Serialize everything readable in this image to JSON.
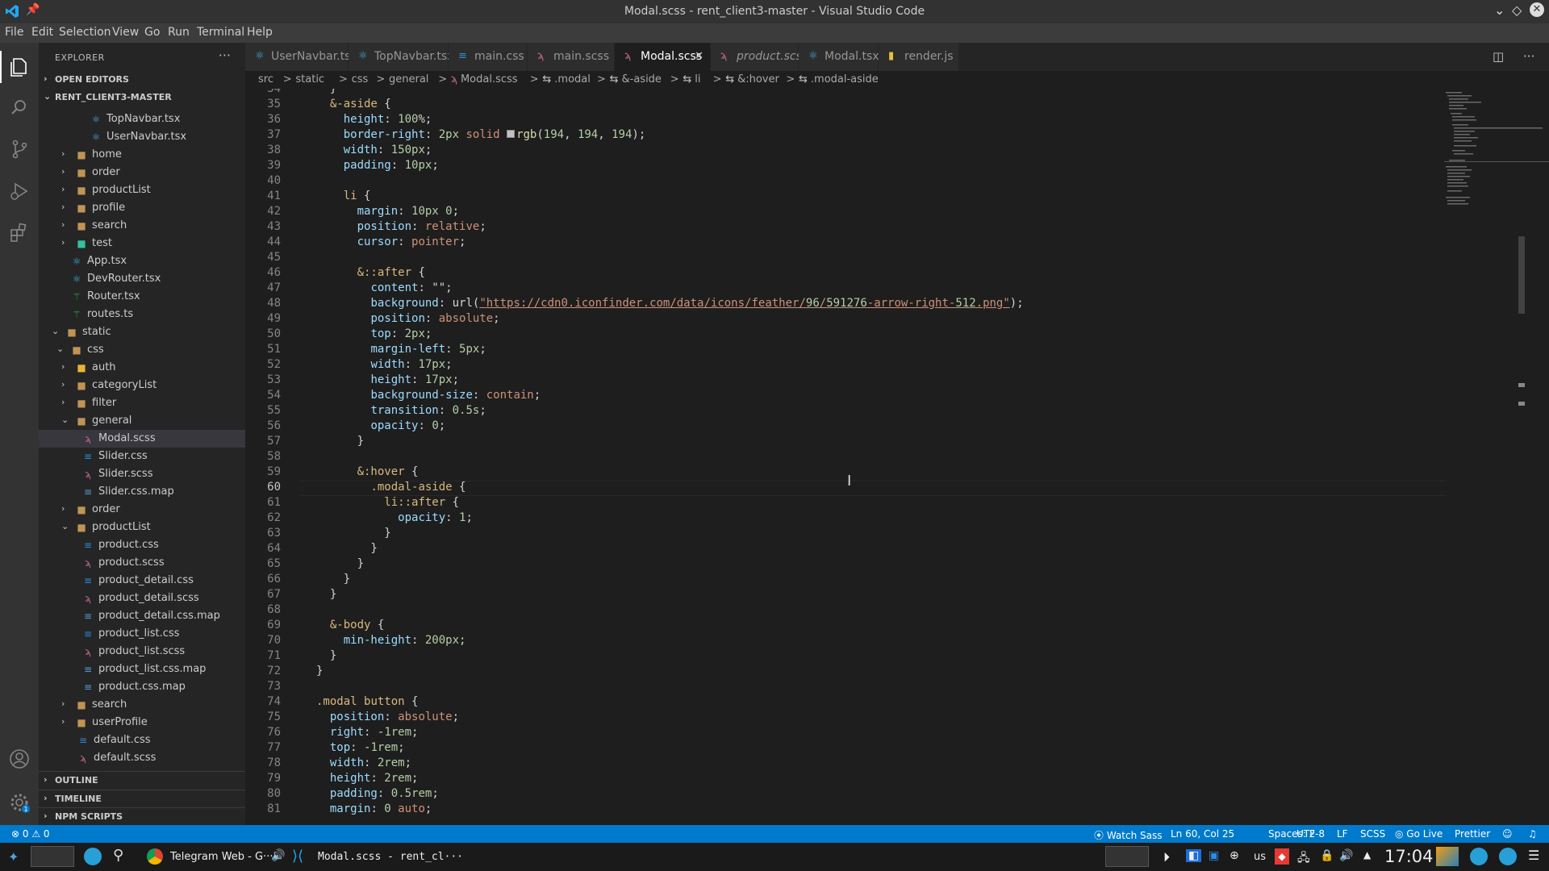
{
  "window": {
    "title": "Modal.scss - rent_client3-master - Visual Studio Code"
  },
  "menu": [
    "File",
    "Edit",
    "Selection",
    "View",
    "Go",
    "Run",
    "Terminal",
    "Help"
  ],
  "explorer": {
    "header": "EXPLORER",
    "more": "···",
    "open_editors": "OPEN EDITORS",
    "project": "RENT_CLIENT3-MASTER",
    "tree": [
      {
        "name": "TopNavbar.tsx",
        "type": "tsx"
      },
      {
        "name": "UserNavbar.tsx",
        "type": "tsx"
      },
      {
        "name": "home",
        "type": "folder"
      },
      {
        "name": "order",
        "type": "folder"
      },
      {
        "name": "productList",
        "type": "folder"
      },
      {
        "name": "profile",
        "type": "folder"
      },
      {
        "name": "search",
        "type": "folder"
      },
      {
        "name": "test",
        "type": "folder-test"
      },
      {
        "name": "App.tsx",
        "type": "tsx"
      },
      {
        "name": "DevRouter.tsx",
        "type": "tsx"
      },
      {
        "name": "Router.tsx",
        "type": "router"
      },
      {
        "name": "routes.ts",
        "type": "router"
      },
      {
        "name": "static",
        "type": "folder-open"
      },
      {
        "name": "css",
        "type": "folder-open"
      },
      {
        "name": "auth",
        "type": "folder-auth"
      },
      {
        "name": "categoryList",
        "type": "folder"
      },
      {
        "name": "filter",
        "type": "folder"
      },
      {
        "name": "general",
        "type": "folder-open"
      },
      {
        "name": "Modal.scss",
        "type": "scss"
      },
      {
        "name": "Slider.css",
        "type": "css"
      },
      {
        "name": "Slider.scss",
        "type": "scss"
      },
      {
        "name": "Slider.css.map",
        "type": "map"
      },
      {
        "name": "order",
        "type": "folder"
      },
      {
        "name": "productList",
        "type": "folder-open"
      },
      {
        "name": "product.css",
        "type": "css"
      },
      {
        "name": "product.scss",
        "type": "scss"
      },
      {
        "name": "product_detail.css",
        "type": "css"
      },
      {
        "name": "product_detail.scss",
        "type": "scss"
      },
      {
        "name": "product_detail.css.map",
        "type": "map"
      },
      {
        "name": "product_list.css",
        "type": "css"
      },
      {
        "name": "product_list.scss",
        "type": "scss"
      },
      {
        "name": "product_list.css.map",
        "type": "map"
      },
      {
        "name": "product.css.map",
        "type": "map"
      },
      {
        "name": "search",
        "type": "folder"
      },
      {
        "name": "userProfile",
        "type": "folder"
      },
      {
        "name": "default.css",
        "type": "css"
      },
      {
        "name": "default.scss",
        "type": "scss"
      }
    ],
    "sections": [
      "OUTLINE",
      "TIMELINE",
      "NPM SCRIPTS"
    ]
  },
  "tabs": [
    {
      "label": "UserNavbar.tsx",
      "type": "tsx"
    },
    {
      "label": "TopNavbar.tsx",
      "type": "tsx"
    },
    {
      "label": "main.css",
      "type": "css"
    },
    {
      "label": "main.scss",
      "type": "scss"
    },
    {
      "label": "Modal.scss",
      "type": "scss",
      "active": true
    },
    {
      "label": "product.scss",
      "type": "scss"
    },
    {
      "label": "Modal.tsx",
      "type": "tsx"
    },
    {
      "label": "render.js",
      "type": "js"
    }
  ],
  "breadcrumb": [
    "src",
    ">",
    "static",
    ">",
    "css",
    ">",
    "general",
    ">",
    "Modal.scss",
    ">",
    ".modal",
    ">",
    "&-aside",
    ">",
    "li",
    ">",
    "&:hover",
    ">",
    ".modal-aside"
  ],
  "code": {
    "first_line": 34,
    "lines": [
      "  }",
      "  &-aside {",
      "    height: 100%;",
      "    border-right: 2px solid ■rgb(194, 194, 194);",
      "    width: 150px;",
      "    padding: 10px;",
      "",
      "    li {",
      "      margin: 10px 0;",
      "      position: relative;",
      "      cursor: pointer;",
      "",
      "      &::after {",
      "        content: \"\";",
      "        background: url(\"https://cdn0.iconfinder.com/data/icons/feather/96/591276-arrow-right-512.png\");",
      "        position: absolute;",
      "        top: 2px;",
      "        margin-left: 5px;",
      "        width: 17px;",
      "        height: 17px;",
      "        background-size: contain;",
      "        transition: 0.5s;",
      "        opacity: 0;",
      "      }",
      "",
      "      &:hover {",
      "        .modal-aside {",
      "          li::after {",
      "            opacity: 1;",
      "          }",
      "        }",
      "      }",
      "    }",
      "  }",
      "",
      "  &-body {",
      "    min-height: 200px;",
      "  }",
      "}",
      "",
      ".modal button {",
      "  position: absolute;",
      "  right: -1rem;",
      "  top: -1rem;",
      "  width: 2rem;",
      "  height: 2rem;",
      "  padding: 0.5rem;",
      "  margin: 0 auto;"
    ]
  },
  "status": {
    "errors": "⊗ 0 ⚠ 0",
    "watch_sass": "Watch Sass",
    "position": "Ln 60, Col 25",
    "spaces": "Spaces: 2",
    "encoding": "UTF-8",
    "eol": "LF",
    "language": "SCSS",
    "golive": "Go Live",
    "prettier": "Prettier"
  },
  "taskbar": {
    "chrome_title": "Telegram Web - G···",
    "vscode_title": "Modal.scss - rent_cl···",
    "lang": "us",
    "clock": "17:04"
  },
  "colors": {
    "accent": "#007acc",
    "activity": "#333333",
    "sidebar": "#252526",
    "editor": "#1e1e1e"
  }
}
